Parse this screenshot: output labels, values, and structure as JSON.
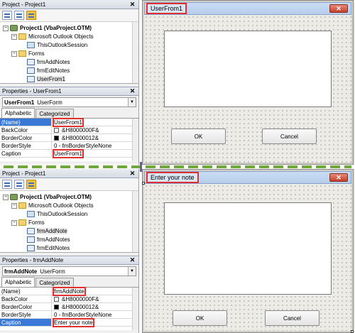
{
  "top": {
    "project_pane": {
      "title": "Project - Project1",
      "close_glyph": "✕",
      "root": "Project1 (VbaProject.OTM)",
      "nodes": [
        {
          "label": "Microsoft Outlook Objects",
          "icon": "folder-icon"
        },
        {
          "label": "ThisOutlookSession",
          "icon": "module-icon"
        },
        {
          "label": "Forms",
          "icon": "folder-icon"
        },
        {
          "label": "frmAddNotes",
          "icon": "form-icon"
        },
        {
          "label": "frmEditNotes",
          "icon": "form-icon"
        },
        {
          "label": "UserFrom1",
          "icon": "form-icon"
        }
      ]
    },
    "properties_pane": {
      "title": "Properties - UserFrom1",
      "close_glyph": "✕",
      "object_name": "UserFrom1",
      "object_type": "UserForm",
      "tabs": [
        "Alphabetic",
        "Categorized"
      ],
      "rows": [
        {
          "name": "(Name)",
          "value": "UserFrom1"
        },
        {
          "name": "BackColor",
          "value": "&H8000000F&",
          "swatch": "#ffffff"
        },
        {
          "name": "BorderColor",
          "value": "&H80000012&",
          "swatch": "#000000"
        },
        {
          "name": "BorderStyle",
          "value": "0 - fmBorderStyleNone"
        },
        {
          "name": "Caption",
          "value": "UserFrom1"
        }
      ]
    },
    "designer": {
      "caption": "UserFrom1",
      "close_glyph": "✕",
      "ok_label": "OK",
      "cancel_label": "Cancel"
    }
  },
  "bottom": {
    "project_pane": {
      "title": "Project - Project1",
      "close_glyph": "✕",
      "root": "Project1 (VbaProject.OTM)",
      "nodes": [
        {
          "label": "Microsoft Outlook Objects",
          "icon": "folder-icon"
        },
        {
          "label": "ThisOutlookSession",
          "icon": "module-icon"
        },
        {
          "label": "Forms",
          "icon": "folder-icon"
        },
        {
          "label": "frmAddNote",
          "icon": "form-icon"
        },
        {
          "label": "frmAddNotes",
          "icon": "form-icon"
        },
        {
          "label": "frmEditNotes",
          "icon": "form-icon"
        }
      ]
    },
    "properties_pane": {
      "title": "Properties - frmAddNote",
      "close_glyph": "✕",
      "object_name": "frmAddNote",
      "object_type": "UserForm",
      "tabs": [
        "Alphabetic",
        "Categorized"
      ],
      "rows": [
        {
          "name": "(Name)",
          "value": "frmAddNote"
        },
        {
          "name": "BackColor",
          "value": "&H8000000F&",
          "swatch": "#ffffff"
        },
        {
          "name": "BorderColor",
          "value": "&H80000012&",
          "swatch": "#000000"
        },
        {
          "name": "BorderStyle",
          "value": "0 - fmBorderStyleNone"
        },
        {
          "name": "Caption",
          "value": "Enter your note"
        }
      ]
    },
    "designer": {
      "caption": "Enter your note",
      "close_glyph": "✕",
      "ok_label": "OK",
      "cancel_label": "Cancel"
    }
  },
  "colors": {
    "highlight": "#e03030",
    "selection": "#3a78d8",
    "divider": "#6fa83a"
  }
}
